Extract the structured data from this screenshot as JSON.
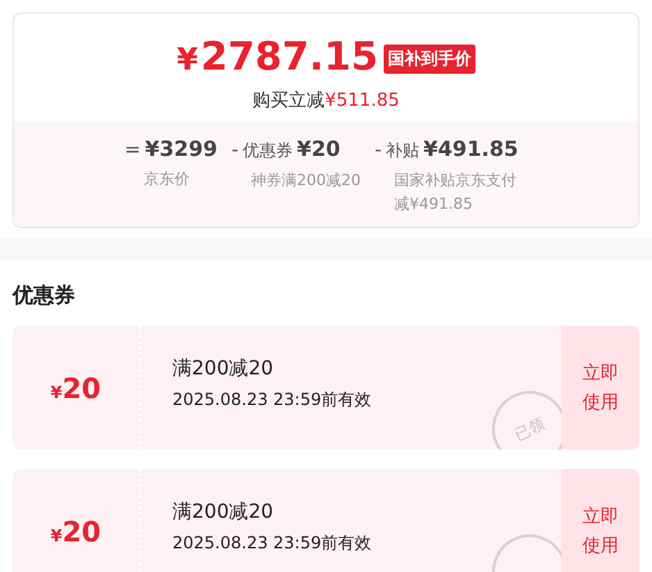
{
  "price_card": {
    "final_price_symbol": "¥",
    "final_price": "2787.15",
    "price_tag": "国补到手价",
    "saving_label": "购买立减",
    "saving_amount": "¥511.85",
    "breakdown": [
      {
        "operator": "=",
        "amount": "¥3299",
        "note": "京东价"
      },
      {
        "operator": "-",
        "label": "优惠券",
        "amount": "¥20",
        "note": "神券满200减20"
      },
      {
        "operator": "-",
        "label": "补贴",
        "amount": "¥491.85",
        "note": "国家补贴京东支付减¥491.85"
      }
    ]
  },
  "coupons_section": {
    "title": "优惠券",
    "coupons": [
      {
        "symbol": "¥",
        "amount": "20",
        "condition": "满200减20",
        "validity": "2025.08.23 23:59前有效",
        "action": "立即使用",
        "claimed": true,
        "stamp": "已领"
      },
      {
        "symbol": "¥",
        "amount": "20",
        "condition": "满200减20",
        "validity": "2025.08.23 23:59前有效",
        "action": "立即使用",
        "claimed": true
      }
    ]
  }
}
